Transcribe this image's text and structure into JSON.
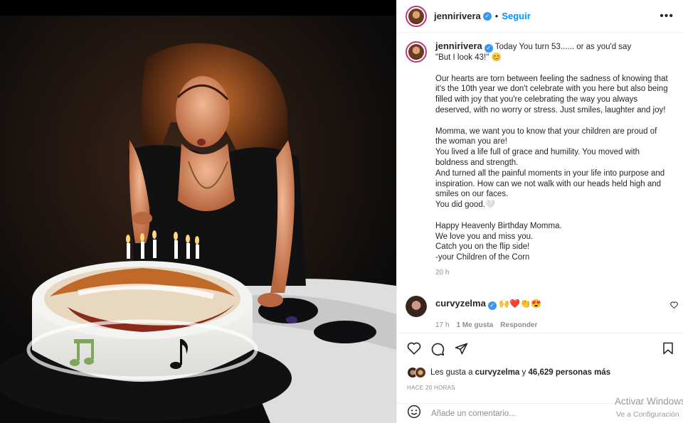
{
  "post": {
    "username": "jennirivera",
    "follow_label": "Seguir",
    "more_label": "•••",
    "caption_lines": [
      "Today You turn 53...... or as you'd say",
      "\"But I look 43!\" 😊",
      "",
      "Our hearts are torn between feeling the sadness of knowing that",
      "it's the 10th year we don't celebrate with you here but also being",
      "filled with joy that you're celebrating the way you always",
      "deserved, with no worry or stress. Just smiles, laughter and joy!",
      "",
      "Momma, we want you to know that your children are proud of",
      "the woman you are!",
      "You lived a life full of grace and humility. You moved with",
      "boldness and strength.",
      "And turned all the painful moments in your life into purpose and",
      "inspiration. How can we not walk with our heads held high and",
      "smiles on our faces.",
      "You did good.🤍",
      "",
      "Happy Heavenly Birthday Momma.",
      "We love you and miss you.",
      "Catch you on the flip side!",
      "-your Children of the Corn"
    ],
    "caption_time": "20 h",
    "likes_prefix": "Les gusta a",
    "likes_user": "curvyzelma",
    "likes_connector": "y",
    "likes_count": "46,629 personas más",
    "ago": "HACE 20 HORAS",
    "add_comment_placeholder": "Añade un comentario..."
  },
  "comment": {
    "username": "curvyzelma",
    "text": "🙌❤️👏😍",
    "time": "17 h",
    "likes": "1 Me gusta",
    "reply": "Responder"
  },
  "watermark": {
    "line1": "Activar Windows",
    "line2": "Ve a Configuración"
  },
  "colors": {
    "accent": "#0095f6",
    "verified": "#3897f0",
    "muted": "#8e8e8e"
  }
}
